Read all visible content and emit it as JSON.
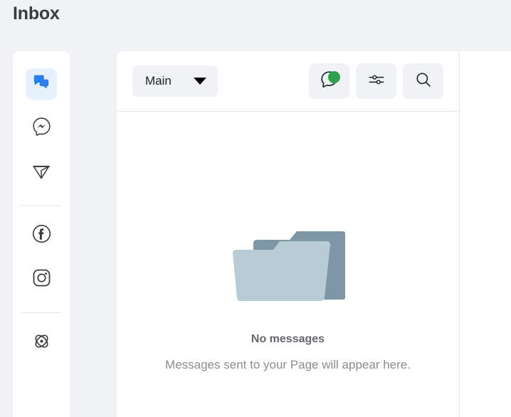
{
  "page": {
    "title": "Inbox",
    "background_color": "#f0f2f5",
    "panel_color": "#ffffff"
  },
  "sidebar": {
    "items": [
      {
        "name": "all-messages",
        "icon": "chat-bubbles-icon",
        "active": true,
        "active_bg": "#e7f0fd",
        "icon_color": "#1b74e4"
      },
      {
        "name": "messenger",
        "icon": "messenger-icon",
        "active": false,
        "icon_color": "#3a3b3c"
      },
      {
        "name": "instagram-direct",
        "icon": "paper-plane-icon",
        "active": false,
        "icon_color": "#3a3b3c"
      },
      {
        "name": "facebook",
        "icon": "facebook-icon",
        "active": false,
        "icon_color": "#3a3b3c"
      },
      {
        "name": "instagram",
        "icon": "instagram-icon",
        "active": false,
        "icon_color": "#3a3b3c"
      },
      {
        "name": "automations",
        "icon": "atom-icon",
        "active": false,
        "icon_color": "#3a3b3c"
      }
    ]
  },
  "toolbar": {
    "folder_select": {
      "label": "Main",
      "caret_icon": "chevron-down-icon"
    },
    "actions": [
      {
        "name": "status-chat",
        "icon": "chat-outline-icon",
        "badge": true,
        "badge_color": "#31a24c"
      },
      {
        "name": "filters",
        "icon": "sliders-icon",
        "badge": false
      },
      {
        "name": "search",
        "icon": "search-icon",
        "badge": false
      }
    ]
  },
  "empty_state": {
    "illustration": "empty-folder-icon",
    "illustration_colors": {
      "back": "#7d97a6",
      "front": "#b8ccd6"
    },
    "title": "No messages",
    "subtitle": "Messages sent to your Page will appear here."
  }
}
